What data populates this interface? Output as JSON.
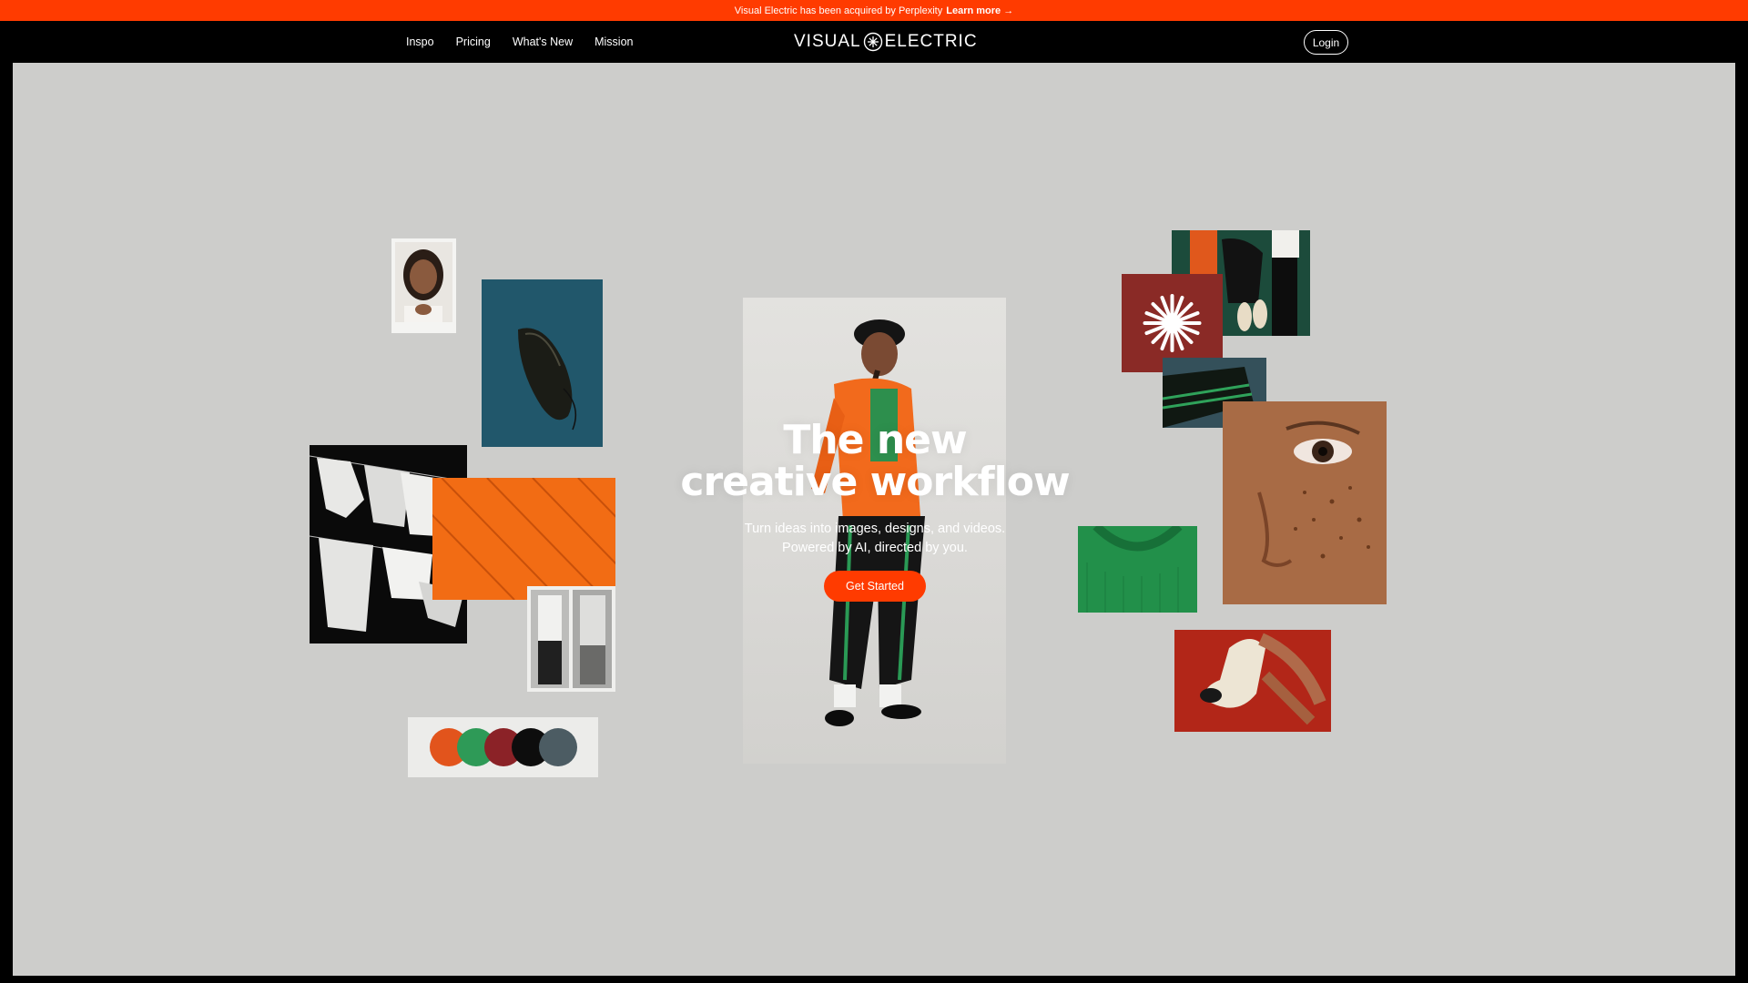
{
  "banner": {
    "text": "Visual Electric has been acquired by Perplexity",
    "link": "Learn more →"
  },
  "nav": {
    "links": [
      "Inspo",
      "Pricing",
      "What's New",
      "Mission"
    ],
    "logo_left": "VISUAL",
    "logo_right": "ELECTRIC",
    "login": "Login"
  },
  "hero": {
    "title": "The new\ncreative workflow",
    "subtitle": "Turn ideas into images, designs, and videos.\nPowered by AI, directed by you.",
    "cta": "Get Started"
  },
  "colors": {
    "accent": "#ff3b00",
    "canvas": "#cdcdcb",
    "swatches": [
      "#e2541c",
      "#2e9a57",
      "#8b2227",
      "#0d0d0d",
      "#4c5c63"
    ]
  },
  "collage": [
    "portrait-polaroid",
    "black-shoe-on-blue",
    "white-shirts-on-line",
    "orange-quilted-fabric",
    "shirt-photo-strips",
    "color-swatch-card",
    "hero-model-orange-jacket",
    "shoes-bag-photo",
    "asterisk-logo-tile",
    "green-stripe-pants",
    "freckled-face-closeup",
    "green-knit-collar",
    "sock-on-red"
  ]
}
